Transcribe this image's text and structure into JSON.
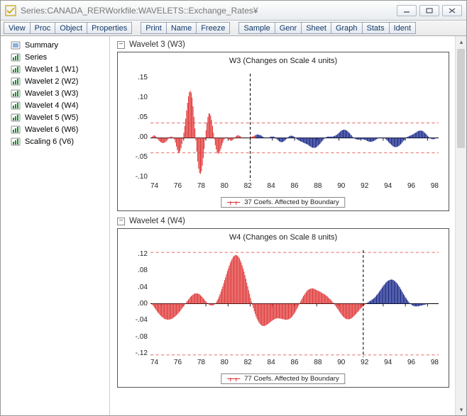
{
  "window": {
    "series_label": "Series: ",
    "series_name": "CANADA_RER",
    "workfile_label": "   Workfile: ",
    "workfile_name": "WAVELETS::Exchange_Rates¥"
  },
  "toolbar": {
    "groups": [
      [
        "View",
        "Proc",
        "Object",
        "Properties"
      ],
      [
        "Print",
        "Name",
        "Freeze"
      ],
      [
        "Sample",
        "Genr",
        "Sheet",
        "Graph",
        "Stats",
        "Ident"
      ]
    ]
  },
  "tree": {
    "items": [
      {
        "label": "Summary",
        "type": "summary"
      },
      {
        "label": "Series",
        "type": "series"
      },
      {
        "label": "Wavelet 1 (W1)",
        "type": "series"
      },
      {
        "label": "Wavelet 2 (W2)",
        "type": "series"
      },
      {
        "label": "Wavelet 3 (W3)",
        "type": "series"
      },
      {
        "label": "Wavelet 4 (W4)",
        "type": "series"
      },
      {
        "label": "Wavelet 5 (W5)",
        "type": "series"
      },
      {
        "label": "Wavelet 6 (W6)",
        "type": "series"
      },
      {
        "label": "Scaling 6 (V6)",
        "type": "series"
      }
    ]
  },
  "sections": [
    {
      "header": "Wavelet 3 (W3)",
      "chart": {
        "title": "W3 (Changes on Scale 4 units)",
        "legend": "37 Coefs. Affected by Boundary",
        "y_ticks": [
          ".15",
          ".10",
          ".05",
          ".00",
          "-.05",
          "-.10"
        ],
        "x_ticks": [
          "74",
          "76",
          "78",
          "80",
          "82",
          "84",
          "86",
          "88",
          "90",
          "92",
          "94",
          "96",
          "98"
        ]
      }
    },
    {
      "header": "Wavelet 4 (W4)",
      "chart": {
        "title": "W4 (Changes on Scale 8 units)",
        "legend": "77 Coefs. Affected by Boundary",
        "y_ticks": [
          ".12",
          ".08",
          ".04",
          ".00",
          "-.04",
          "-.08",
          "-.12"
        ],
        "x_ticks": [
          "74",
          "76",
          "78",
          "80",
          "82",
          "84",
          "86",
          "88",
          "90",
          "92",
          "94",
          "96",
          "98"
        ]
      }
    }
  ],
  "chart_data": [
    {
      "type": "bar",
      "title": "W3 (Changes on Scale 4 units)",
      "xlabel": "",
      "ylabel": "",
      "ylim": [
        -0.1,
        0.15
      ],
      "red_zero_dash": [
        -0.035,
        0.035
      ],
      "boundary_vline_x": 82,
      "x_range": [
        73,
        99
      ],
      "boundary_cutoff_index": 113,
      "n_points": 312,
      "series": [
        {
          "name": "37 Coefs. Affected by Boundary",
          "values": [
            0,
            0,
            0.003,
            0.005,
            0.006,
            0.005,
            0.003,
            0,
            -0.003,
            -0.006,
            -0.008,
            -0.01,
            -0.011,
            -0.012,
            -0.012,
            -0.011,
            -0.01,
            -0.008,
            -0.006,
            -0.003,
            0,
            0.002,
            0.003,
            0.003,
            0.001,
            0,
            -0.004,
            -0.011,
            -0.02,
            -0.028,
            -0.034,
            -0.035,
            -0.031,
            -0.024,
            -0.014,
            -0.002,
            0.012,
            0.028,
            0.045,
            0.064,
            0.082,
            0.097,
            0.107,
            0.11,
            0.106,
            0.094,
            0.074,
            0.049,
            0.022,
            -0.006,
            -0.032,
            -0.055,
            -0.072,
            -0.082,
            -0.084,
            -0.078,
            -0.065,
            -0.047,
            -0.026,
            -0.003,
            0.018,
            0.036,
            0.049,
            0.057,
            0.057,
            0.052,
            0.042,
            0.028,
            0.012,
            -0.003,
            -0.017,
            -0.027,
            -0.034,
            -0.037,
            -0.035,
            -0.031,
            -0.025,
            -0.018,
            -0.012,
            -0.006,
            -0.002,
            0,
            0.001,
            0,
            -0.002,
            -0.004,
            -0.006,
            -0.007,
            -0.006,
            -0.005,
            -0.002,
            0.001,
            0.003,
            0.005,
            0.006,
            0.006,
            0.005,
            0.004,
            0.002,
            0.001,
            0,
            0,
            0,
            0,
            0,
            0.001,
            0.001,
            0.001,
            0.002,
            0.002,
            0.003,
            0.004,
            0.005,
            0.006,
            0.007,
            0.008,
            0.008,
            0.007,
            0.007,
            0.006,
            0.005,
            0.003,
            0.002,
            0.001,
            0.001,
            0,
            0,
            0.001,
            0.001,
            0.002,
            0.003,
            0.003,
            0.003,
            0.003,
            0.002,
            0,
            -0.002,
            -0.004,
            -0.006,
            -0.008,
            -0.009,
            -0.01,
            -0.01,
            -0.009,
            -0.008,
            -0.006,
            -0.004,
            -0.002,
            0,
            0.002,
            0.004,
            0.005,
            0.005,
            0.005,
            0.004,
            0.003,
            0.001,
            -0.001,
            -0.003,
            -0.004,
            -0.006,
            -0.007,
            -0.008,
            -0.009,
            -0.01,
            -0.011,
            -0.012,
            -0.013,
            -0.014,
            -0.015,
            -0.016,
            -0.018,
            -0.019,
            -0.021,
            -0.022,
            -0.023,
            -0.023,
            -0.023,
            -0.023,
            -0.022,
            -0.02,
            -0.018,
            -0.016,
            -0.014,
            -0.011,
            -0.008,
            -0.006,
            -0.003,
            -0.001,
            0.001,
            0.002,
            0.003,
            0.003,
            0.003,
            0.003,
            0.003,
            0.003,
            0.003,
            0.004,
            0.005,
            0.006,
            0.007,
            0.009,
            0.011,
            0.013,
            0.015,
            0.017,
            0.018,
            0.019,
            0.019,
            0.019,
            0.018,
            0.017,
            0.015,
            0.013,
            0.011,
            0.008,
            0.006,
            0.003,
            0.001,
            -0.001,
            -0.002,
            -0.003,
            -0.004,
            -0.004,
            -0.004,
            -0.004,
            -0.003,
            -0.003,
            -0.003,
            -0.004,
            -0.004,
            -0.005,
            -0.006,
            -0.007,
            -0.008,
            -0.009,
            -0.009,
            -0.009,
            -0.009,
            -0.008,
            -0.007,
            -0.006,
            -0.005,
            -0.003,
            -0.002,
            -0.001,
            0,
            0.001,
            0.001,
            0.001,
            0.001,
            0,
            -0.001,
            -0.003,
            -0.005,
            -0.007,
            -0.01,
            -0.012,
            -0.014,
            -0.016,
            -0.018,
            -0.02,
            -0.021,
            -0.021,
            -0.022,
            -0.021,
            -0.02,
            -0.019,
            -0.017,
            -0.015,
            -0.013,
            -0.01,
            -0.007,
            -0.005,
            -0.002,
            0,
            0.002,
            0.003,
            0.004,
            0.005,
            0.006,
            0.007,
            0.008,
            0.009,
            0.011,
            0.012,
            0.013,
            0.015,
            0.016,
            0.017,
            0.017,
            0.017,
            0.017,
            0.016,
            0.014,
            0.012,
            0.01,
            0.008,
            0.005,
            0.003,
            0.001,
            -0.001,
            -0.002,
            -0.003,
            -0.003,
            -0.003,
            -0.002,
            -0.001,
            0
          ]
        }
      ]
    },
    {
      "type": "bar",
      "title": "W4 (Changes on Scale 8 units)",
      "xlabel": "",
      "ylabel": "",
      "ylim": [
        -0.12,
        0.12
      ],
      "red_zero_dash": [
        -0.115,
        0.115
      ],
      "boundary_vline_x": 92.2,
      "x_range": [
        73,
        99
      ],
      "boundary_cutoff_index": 232,
      "n_points": 312,
      "series": [
        {
          "name": "77 Coefs. Affected by Boundary",
          "values": [
            0,
            0,
            -0.002,
            -0.005,
            -0.008,
            -0.011,
            -0.014,
            -0.017,
            -0.02,
            -0.022,
            -0.025,
            -0.027,
            -0.029,
            -0.031,
            -0.032,
            -0.034,
            -0.035,
            -0.035,
            -0.036,
            -0.036,
            -0.036,
            -0.035,
            -0.035,
            -0.034,
            -0.033,
            -0.031,
            -0.03,
            -0.028,
            -0.026,
            -0.024,
            -0.022,
            -0.019,
            -0.017,
            -0.014,
            -0.011,
            -0.008,
            -0.005,
            -0.002,
            0.001,
            0.004,
            0.007,
            0.009,
            0.012,
            0.015,
            0.017,
            0.019,
            0.02,
            0.022,
            0.023,
            0.023,
            0.023,
            0.023,
            0.022,
            0.021,
            0.019,
            0.017,
            0.015,
            0.012,
            0.01,
            0.007,
            0.005,
            0.002,
            0,
            -0.002,
            -0.003,
            -0.004,
            -0.004,
            -0.004,
            -0.003,
            -0.002,
            0.001,
            0.003,
            0.007,
            0.011,
            0.016,
            0.021,
            0.027,
            0.033,
            0.039,
            0.046,
            0.053,
            0.059,
            0.066,
            0.073,
            0.079,
            0.085,
            0.091,
            0.096,
            0.1,
            0.104,
            0.107,
            0.108,
            0.109,
            0.109,
            0.107,
            0.105,
            0.102,
            0.097,
            0.092,
            0.086,
            0.079,
            0.072,
            0.064,
            0.056,
            0.047,
            0.039,
            0.03,
            0.022,
            0.013,
            0.005,
            -0.003,
            -0.01,
            -0.017,
            -0.023,
            -0.029,
            -0.034,
            -0.038,
            -0.042,
            -0.045,
            -0.047,
            -0.049,
            -0.05,
            -0.05,
            -0.05,
            -0.049,
            -0.048,
            -0.047,
            -0.045,
            -0.044,
            -0.042,
            -0.04,
            -0.039,
            -0.037,
            -0.036,
            -0.035,
            -0.034,
            -0.033,
            -0.033,
            -0.033,
            -0.033,
            -0.033,
            -0.034,
            -0.034,
            -0.035,
            -0.035,
            -0.036,
            -0.036,
            -0.036,
            -0.036,
            -0.035,
            -0.034,
            -0.033,
            -0.031,
            -0.029,
            -0.026,
            -0.023,
            -0.02,
            -0.016,
            -0.012,
            -0.008,
            -0.004,
            0.001,
            0.005,
            0.009,
            0.013,
            0.017,
            0.02,
            0.023,
            0.026,
            0.029,
            0.031,
            0.032,
            0.033,
            0.034,
            0.034,
            0.034,
            0.034,
            0.033,
            0.032,
            0.031,
            0.03,
            0.029,
            0.028,
            0.027,
            0.026,
            0.024,
            0.023,
            0.022,
            0.021,
            0.019,
            0.018,
            0.016,
            0.014,
            0.012,
            0.01,
            0.008,
            0.005,
            0.003,
            0,
            -0.003,
            -0.006,
            -0.009,
            -0.012,
            -0.015,
            -0.018,
            -0.021,
            -0.024,
            -0.027,
            -0.029,
            -0.031,
            -0.033,
            -0.034,
            -0.035,
            -0.035,
            -0.035,
            -0.035,
            -0.034,
            -0.033,
            -0.031,
            -0.029,
            -0.027,
            -0.025,
            -0.023,
            -0.02,
            -0.018,
            -0.016,
            -0.013,
            -0.011,
            -0.009,
            -0.007,
            -0.005,
            -0.003,
            -0.001,
            0,
            0.002,
            0.003,
            0.005,
            0.006,
            0.007,
            0.009,
            0.01,
            0.012,
            0.014,
            0.016,
            0.019,
            0.021,
            0.024,
            0.027,
            0.03,
            0.033,
            0.036,
            0.039,
            0.042,
            0.044,
            0.047,
            0.049,
            0.051,
            0.052,
            0.053,
            0.054,
            0.054,
            0.054,
            0.053,
            0.052,
            0.05,
            0.048,
            0.046,
            0.043,
            0.04,
            0.037,
            0.033,
            0.03,
            0.026,
            0.022,
            0.019,
            0.015,
            0.012,
            0.009,
            0.006,
            0.003,
            0.001,
            -0.001,
            -0.003,
            -0.004,
            -0.005,
            -0.006,
            -0.006,
            -0.006,
            -0.006,
            -0.006,
            -0.005,
            -0.005,
            -0.004,
            -0.004,
            -0.003,
            -0.003,
            -0.002,
            -0.002,
            -0.001,
            -0.001,
            0,
            0,
            0,
            0,
            0,
            0,
            0,
            0,
            0,
            0,
            0,
            0
          ]
        }
      ]
    }
  ]
}
